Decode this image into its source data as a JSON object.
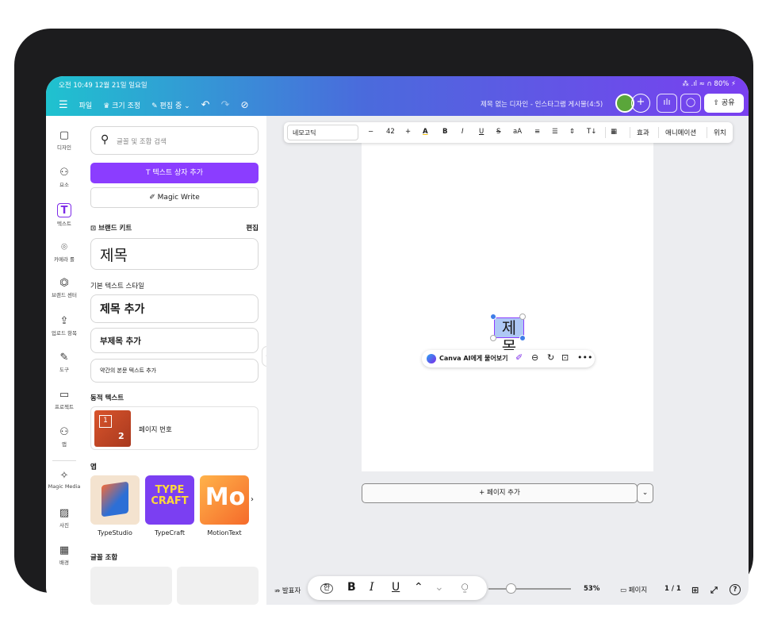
{
  "status": {
    "time_date": "오전 10:49  12월 21일 일요일",
    "right": "⁂ .ıl ≈ ∩ 80% ⚡"
  },
  "topbar": {
    "menu_icon": "☰",
    "file": "파일",
    "resize": "♛ 크기 조정",
    "editing": "✎ 편집 중 ⌄",
    "undo": "↶",
    "redo": "↷",
    "cloud": "⊘",
    "doc_title": "제목 없는 디자인 - 인스타그램 게시물(4:5)",
    "add_collaborator": "+",
    "chart_icon": "ılı",
    "comment_icon": "◯",
    "share": "⇧ 공유"
  },
  "rail": [
    {
      "icon": "▢",
      "label": "디자인"
    },
    {
      "icon": "⚇",
      "label": "요소"
    },
    {
      "icon": "T",
      "label": "텍스트"
    },
    {
      "icon": "⌾",
      "label": "카메라 롤"
    },
    {
      "icon": "⏣",
      "label": "브랜드 센터"
    },
    {
      "icon": "⇪",
      "label": "업로드 항목"
    },
    {
      "icon": "✎",
      "label": "도구"
    },
    {
      "icon": "▭",
      "label": "프로젝트"
    },
    {
      "icon": "⚇",
      "label": "앱"
    },
    {
      "icon": "✧",
      "label": "Magic Media"
    },
    {
      "icon": "▨",
      "label": "사진"
    },
    {
      "icon": "▦",
      "label": "배경"
    }
  ],
  "panel": {
    "search_placeholder": "글꼴 및 조합 검색",
    "add_textbox": "T  텍스트 상자 추가",
    "magic_write": "✐  Magic Write",
    "brand_kit": "브랜드 키트",
    "edit": "편집",
    "brand_heading": "제목",
    "default_styles": "기본 텍스트 스타일",
    "add_heading": "제목 추가",
    "add_subheading": "부제목 추가",
    "add_body": "약간의 본문 텍스트 추가",
    "dynamic_text": "동적 텍스트",
    "page_number": "페이지 번호",
    "page_number_thumb": "1",
    "page_number_thumb_2": "2",
    "apps": "앱",
    "app_names": [
      "TypeStudio",
      "TypeCraft",
      "MotionText"
    ],
    "font_combos": "글꼴 조합"
  },
  "format_toolbar": {
    "font": "네모고딕",
    "minus": "−",
    "size": "42",
    "plus": "+",
    "color": "A",
    "bold": "B",
    "italic": "I",
    "underline": "U",
    "strike": "S",
    "case": "aA",
    "align": "≡",
    "list": "☰",
    "spacing": "⇕",
    "vertical": "T↓",
    "transparency": "▦",
    "effects": "효과",
    "animate": "애니메이션",
    "position": "위치"
  },
  "canvas": {
    "selected_text": "제목",
    "ai_ask": "Canva AI에게 물어보기",
    "add_page": "+ 페이지 추가",
    "add_page_dropdown": "⌄"
  },
  "bottom": {
    "presenter_notes": "⇏ 발표자",
    "zoom": "53%",
    "pages": "▭ 페이지",
    "page_count": "1 / 1",
    "grid": "⊞",
    "fullscreen": "⤢",
    "help": "?"
  },
  "floating_format": {
    "hangul": "한",
    "bold": "B",
    "italic": "I",
    "underline": "U",
    "up": "⌃",
    "down": "⌄",
    "mic": "⍜"
  }
}
